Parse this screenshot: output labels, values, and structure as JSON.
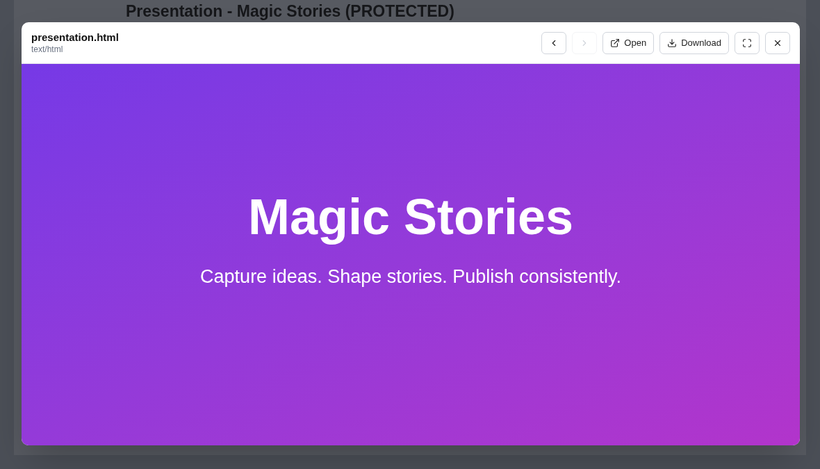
{
  "page": {
    "title": "Presentation - Magic Stories (PROTECTED)"
  },
  "viewer": {
    "file_name": "presentation.html",
    "file_type": "text/html",
    "toolbar": [
      {
        "kind": "previous",
        "disabled": false
      },
      {
        "kind": "next",
        "disabled": true
      },
      {
        "kind": "open",
        "label": "Open",
        "disabled": false
      },
      {
        "kind": "download",
        "label": "Download",
        "disabled": false
      },
      {
        "kind": "fullscreen",
        "disabled": false
      },
      {
        "kind": "close",
        "disabled": false
      }
    ],
    "slide": {
      "title": "Magic Stories",
      "subtitle": "Capture ideas. Shape stories. Publish consistently."
    }
  }
}
